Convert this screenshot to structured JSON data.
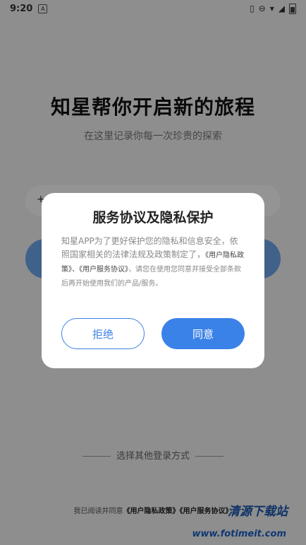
{
  "status_bar": {
    "time": "9:20",
    "notification_icon_letter": "A"
  },
  "hero": {
    "title": "知星帮你开启新的旅程",
    "subtitle": "在这里记录你每一次珍贵的探索"
  },
  "phone_input": {
    "prefix": "+"
  },
  "other_login": {
    "label": "选择其他登录方式"
  },
  "footer": {
    "agree_prefix": "我已阅读并同意",
    "privacy_link": "《用户隐私政策》",
    "service_link": "《用户服务协议》"
  },
  "dialog": {
    "title": "服务协议及隐私保护",
    "body_main": "知星APP为了更好保护您的隐私和信息安全，依照国家相关的法律法规及政策制定了，",
    "privacy_link": "《用户隐私政策》",
    "separator": "、",
    "service_link": "《用户服务协议》",
    "body_rest": "，请您在使用您同意并接受全部条款后再开始使用我们的产品/服务。",
    "decline_label": "拒绝",
    "agree_label": "同意"
  },
  "watermark": {
    "title": "清源下载站",
    "url": "www.fotimeit.com"
  },
  "colors": {
    "primary": "#3b82e8",
    "overlay": "rgba(0,0,0,0.42)"
  }
}
